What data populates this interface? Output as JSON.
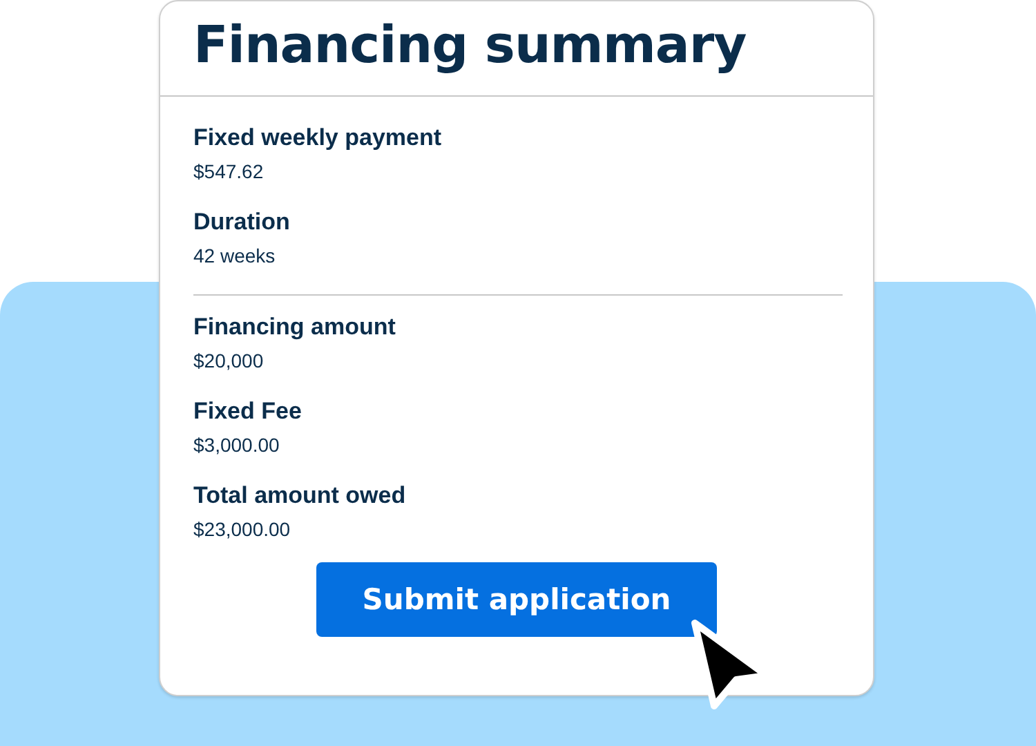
{
  "title": "Financing summary",
  "groups": [
    {
      "items": [
        {
          "label": "Fixed weekly payment",
          "value": "$547.62"
        },
        {
          "label": "Duration",
          "value": "42 weeks"
        }
      ]
    },
    {
      "items": [
        {
          "label": "Financing amount",
          "value": "$20,000"
        },
        {
          "label": "Fixed Fee",
          "value": "$3,000.00"
        },
        {
          "label": "Total amount owed",
          "value": "$23,000.00"
        }
      ]
    }
  ],
  "button": "Submit application"
}
